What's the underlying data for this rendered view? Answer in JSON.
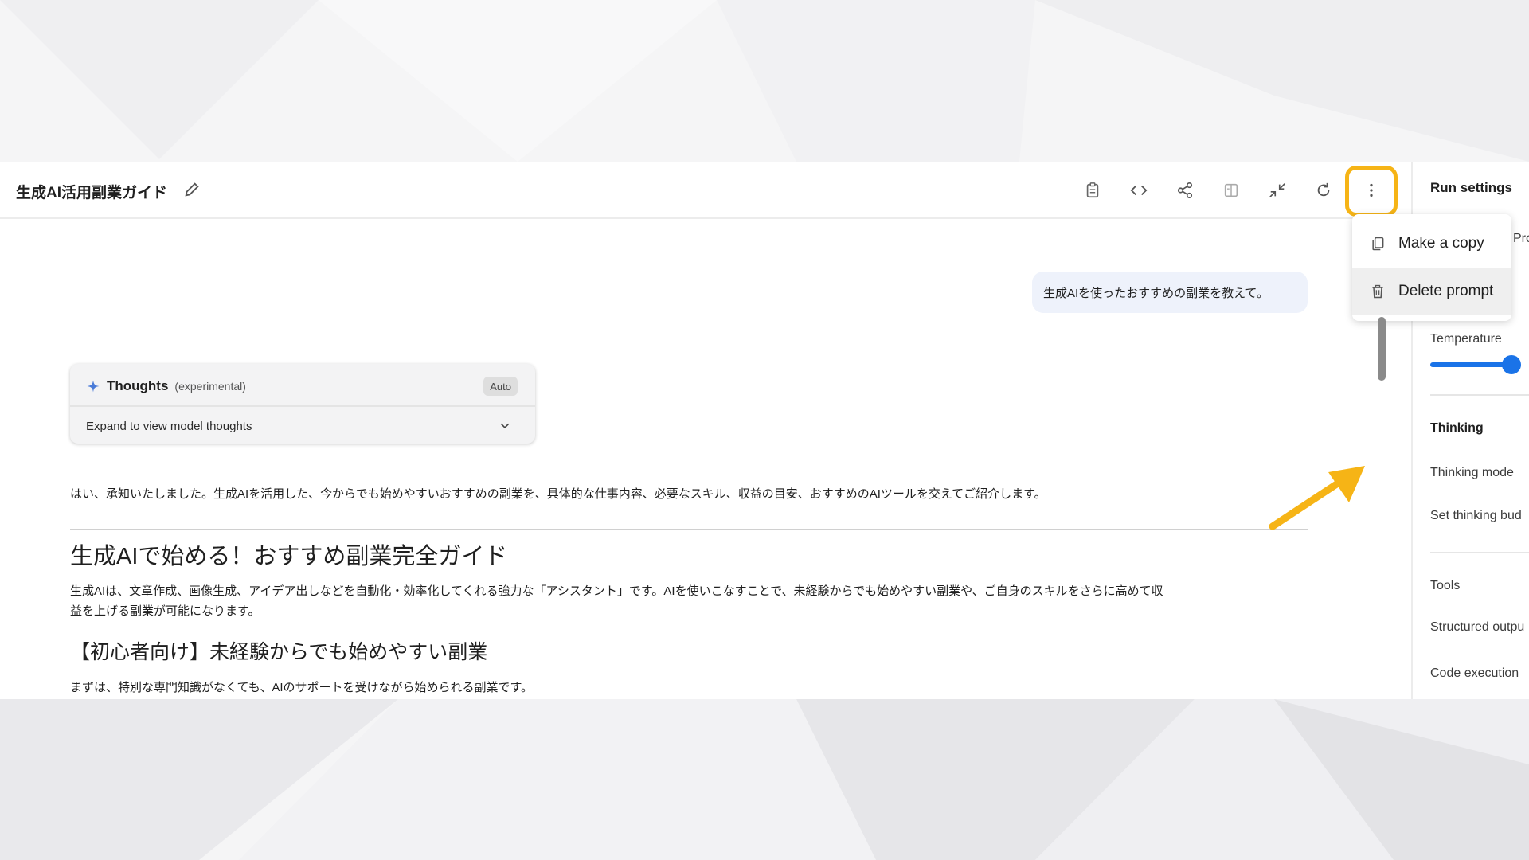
{
  "header": {
    "title": "生成AI活用副業ガイド"
  },
  "toolbar": {
    "icons": [
      "clipboard-icon",
      "code-icon",
      "share-icon",
      "compare-icon",
      "collapse-icon",
      "refresh-icon",
      "more-vert-icon"
    ]
  },
  "menu": {
    "make_copy": "Make a copy",
    "delete_prompt": "Delete prompt"
  },
  "settings": {
    "title": "Run settings",
    "partial_tab": "Pro",
    "temperature": "Temperature",
    "temperature_value_fraction": 0.95,
    "thinking": "Thinking",
    "thinking_mode": "Thinking mode",
    "set_thinking_budget": "Set thinking bud",
    "tools": "Tools",
    "structured_output": "Structured outpu",
    "code_execution": "Code execution"
  },
  "chat": {
    "user_message": "生成AIを使ったおすすめの副業を教えて。",
    "thoughts": {
      "title": "Thoughts",
      "subtitle": "(experimental)",
      "badge": "Auto",
      "expand_label": "Expand to view model thoughts"
    },
    "intro": "はい、承知いたしました。生成AIを活用した、今からでも始めやすいおすすめの副業を、具体的な仕事内容、必要なスキル、収益の目安、おすすめのAIツールを交えてご紹介します。",
    "heading1": "生成AIで始める！おすすめ副業完全ガイド",
    "para1_line1": "生成AIは、文章作成、画像生成、アイデア出しなどを自動化・効率化してくれる強力な「アシスタント」です。AIを使いこなすことで、未経験からでも始めやすい副業や、ご自身のスキルをさらに高めて収",
    "para1_line2": "益を上げる副業が可能になります。",
    "heading2": "【初心者向け】未経験からでも始めやすい副業",
    "para2": "まずは、特別な専門知識がなくても、AIのサポートを受けながら始められる副業です。"
  },
  "colors": {
    "highlight": "#f6b416",
    "accent": "#1a73e8",
    "sparkle": "#4a7bd8"
  }
}
